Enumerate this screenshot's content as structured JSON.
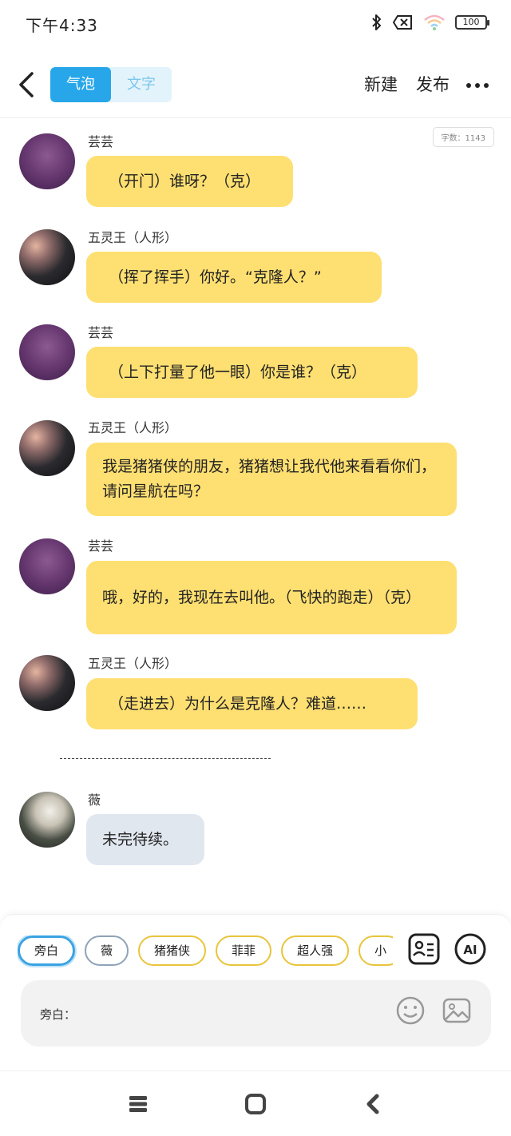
{
  "status_bar": {
    "time": "下午4:33",
    "battery": "100"
  },
  "header": {
    "tabs": [
      {
        "label": "气泡",
        "active": true
      },
      {
        "label": "文字",
        "active": false
      }
    ],
    "new_label": "新建",
    "publish_label": "发布"
  },
  "word_count": "字数：1143",
  "messages": [
    {
      "name": "芸芸",
      "text": "（开门）谁呀？（克）"
    },
    {
      "name": "五灵王（人形）",
      "text": "（挥了挥手）你好。“克隆人？”"
    },
    {
      "name": "芸芸",
      "text": "（上下打量了他一眼）你是谁？（克）"
    },
    {
      "name": "五灵王（人形）",
      "text": "我是猪猪侠的朋友，猪猪想让我代他来看看你们，请问星航在吗？"
    },
    {
      "name": "芸芸",
      "text": "哦，好的，我现在去叫他。（飞快的跑走）（克）"
    },
    {
      "name": "五灵王（人形）",
      "text": "（走进去）为什么是克隆人？难道……"
    },
    {
      "name": "薇",
      "text": "未完待续。"
    }
  ],
  "characters": [
    "旁白",
    "薇",
    "猪猪侠",
    "菲菲",
    "超人强",
    "小"
  ],
  "input": {
    "label": "旁白："
  },
  "colors": {
    "accent": "#27a7ea",
    "bubble": "#fedf71",
    "bubble_gray": "#e1e7ef",
    "chip_border": "#e9c43c"
  }
}
